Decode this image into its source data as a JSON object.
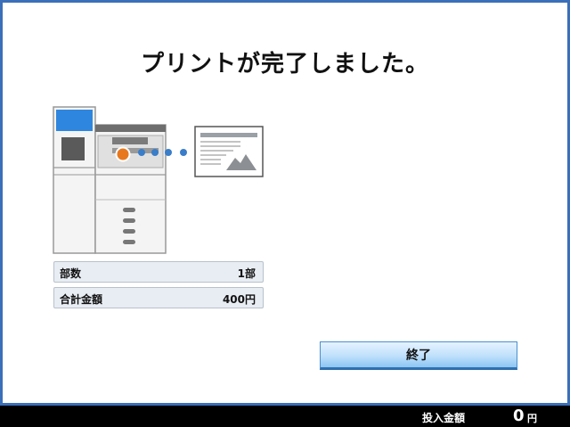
{
  "title": "プリントが完了しました。",
  "info": {
    "copies_label": "部数",
    "copies_value": "1部",
    "total_label": "合計金額",
    "total_value": "400円"
  },
  "buttons": {
    "end_label": "終了"
  },
  "status_bar": {
    "amount_label": "投入金額",
    "amount_value": "0",
    "amount_unit": "円"
  },
  "icons": [
    "printer-illustration",
    "document-icon"
  ],
  "colors": {
    "frame_border": "#3b6fb8",
    "accent_orange": "#e8781e",
    "dot_blue": "#3a7dc9",
    "button_blue": "#bfe0fb"
  }
}
